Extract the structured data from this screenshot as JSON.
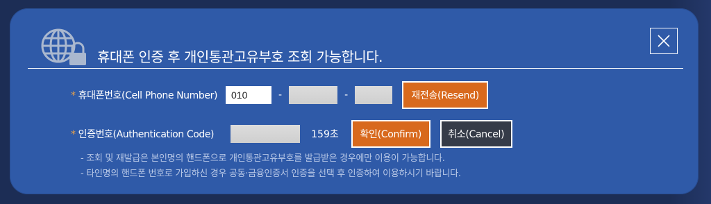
{
  "header": {
    "title": "휴대폰 인증 후 개인통관고유부호 조회 가능합니다.",
    "icon": "globe-lock-icon",
    "close_icon": "close-icon"
  },
  "phone": {
    "required_mark": "*",
    "label": "휴대폰번호(Cell Phone Number)",
    "prefix_value": "010",
    "separator": "-",
    "resend_label": "재전송(Resend)"
  },
  "auth": {
    "required_mark": "*",
    "label": "인증번호(Authentication Code)",
    "timer": "159초",
    "confirm_label": "확인(Confirm)",
    "cancel_label": "취소(Cancel)"
  },
  "notes": [
    "- 조회 및 재발급은 본인명의 핸드폰으로 개인통관고유부호를 발급받은 경우에만 이용이 가능합니다.",
    "- 타인명의 핸드폰 번호로 가입하신 경우 공동·금융인증서 인증을 선택 후 인증하여 이용하시기 바랍니다."
  ],
  "colors": {
    "modal_bg": "#2f5aa8",
    "accent_orange": "#d8691d",
    "dark_button": "#353b48",
    "required_star": "#e8a14a"
  }
}
